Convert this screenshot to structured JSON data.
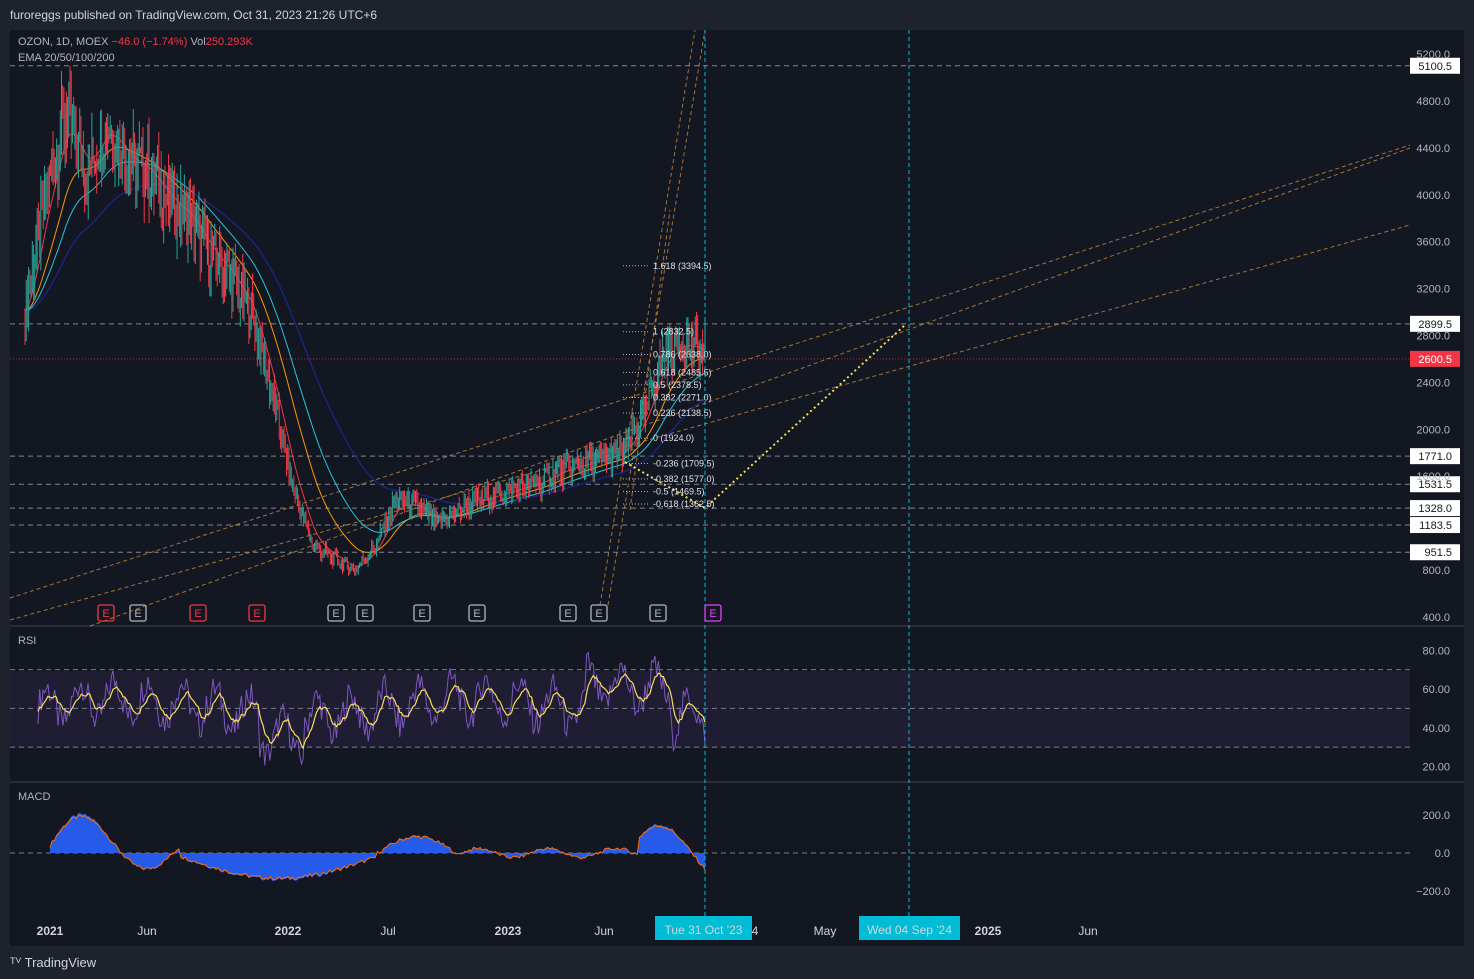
{
  "header": {
    "published": "furoreggs published on TradingView.com, Oct 31, 2023 21:26 UTC+6"
  },
  "legend": {
    "symbol": "OZON, 1D, MOEX",
    "change": "−46.0 (−1.74%)",
    "vol_label": "Vol",
    "vol_value": "250.293K",
    "ema": "EMA 20/50/100/200"
  },
  "panes": {
    "rsi_title": "RSI",
    "macd_title": "MACD"
  },
  "colors": {
    "up": "#26a69a",
    "down": "#f23645",
    "accent": "#00bcd4",
    "rsi": "#7e57c2",
    "signal": "#f7e05a",
    "macd_hist": "#2962ff",
    "earnings_past": "#f23645",
    "earnings_next": "#e040fb"
  },
  "price_scale": [
    "5200.0",
    "4800.0",
    "4400.0",
    "4000.0",
    "3600.0",
    "3200.0",
    "2800.0",
    "2400.0",
    "2000.0",
    "1600.0",
    "800.0",
    "400.0"
  ],
  "rsi_scale": [
    "80.00",
    "60.00",
    "40.00",
    "20.00"
  ],
  "macd_scale": [
    "200.0",
    "0.0",
    "−200.0"
  ],
  "level_tags": [
    "5100.5",
    "2899.5",
    "2600.5",
    "1771.0",
    "1531.5",
    "1328.0",
    "1183.5",
    "951.5"
  ],
  "x_axis": [
    "2021",
    "Jun",
    "2022",
    "Jul",
    "2023",
    "Jun",
    "4",
    "May",
    "2025",
    "Jun"
  ],
  "x_highlights": [
    "Tue 31 Oct '23",
    "Wed 04 Sep '24"
  ],
  "fib_levels": [
    "1.618 (3394.5)",
    "1 (2832.5)",
    "0.786 (2638.0)",
    "0.618 (2485.5)",
    "0.5 (2378.5)",
    "0.382 (2271.0)",
    "0.236 (2138.5)",
    "0 (1924.0)",
    "-0.236 (1709.5)",
    "-0.382 (1577.0)",
    "-0.5 (1469.5)",
    "-0.618 (1362.5)"
  ],
  "earnings_markers": [
    "E",
    "E",
    "E",
    "E",
    "E",
    "E",
    "E",
    "E",
    "E",
    "E",
    "E",
    "E"
  ],
  "footer": {
    "brand": "TradingView"
  },
  "chart_data": {
    "type": "line",
    "symbol": "OZON",
    "interval": "1D",
    "exchange": "MOEX",
    "ylim": [
      400,
      5300
    ],
    "x": [
      "2021-01",
      "2021-02",
      "2021-03",
      "2021-04",
      "2021-05",
      "2021-06",
      "2021-07",
      "2021-08",
      "2021-09",
      "2021-10",
      "2021-11",
      "2021-12",
      "2022-01",
      "2022-02",
      "2022-03",
      "2022-04",
      "2022-05",
      "2022-06",
      "2022-07",
      "2022-08",
      "2022-09",
      "2022-10",
      "2022-11",
      "2022-12",
      "2023-01",
      "2023-02",
      "2023-03",
      "2023-04",
      "2023-05",
      "2023-06",
      "2023-07",
      "2023-08",
      "2023-09",
      "2023-10"
    ],
    "series": [
      {
        "values": [
          3000,
          4000,
          4700,
          4200,
          4600,
          4300,
          4200,
          3950,
          3800,
          3500,
          3300,
          3000,
          2300,
          1500,
          1000,
          900,
          800,
          1000,
          1400,
          1350,
          1200,
          1300,
          1400,
          1450,
          1500,
          1550,
          1650,
          1700,
          1750,
          1800,
          2100,
          2650,
          2750,
          2650
        ]
      }
    ],
    "current_price": 2600.5
  }
}
